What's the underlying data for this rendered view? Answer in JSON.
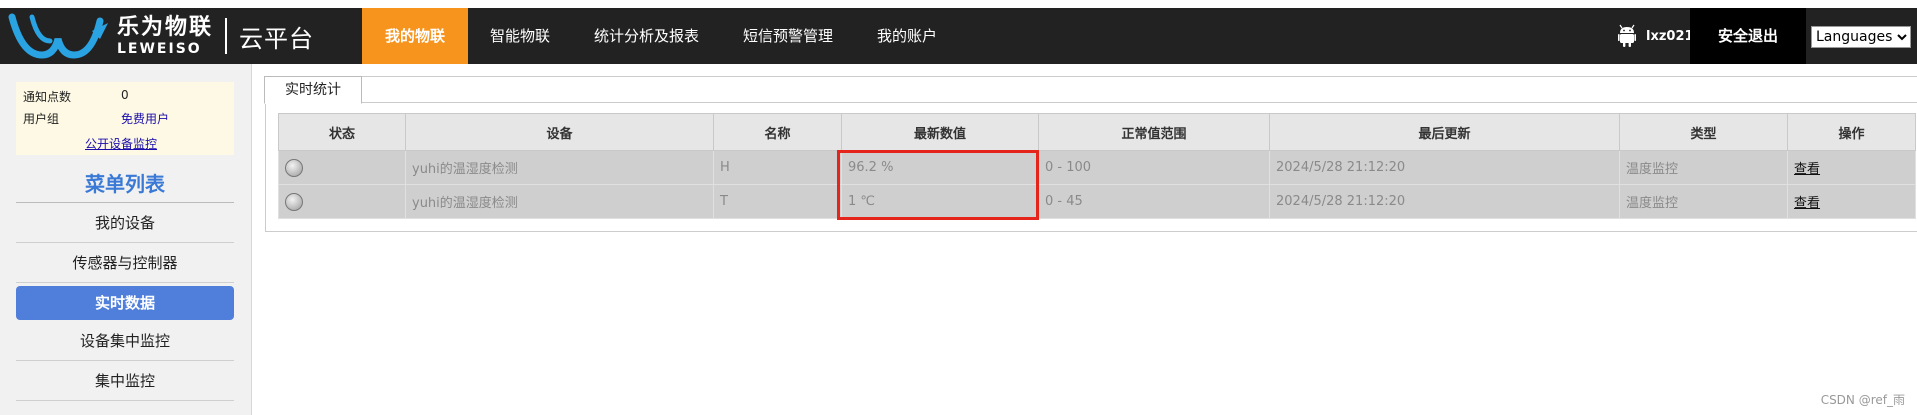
{
  "brand": {
    "name_cn": "乐为物联",
    "name_en": "LEWEISO",
    "product": "云平台",
    "colors": {
      "header_bg": "#222222",
      "active_nav": "#f7941d",
      "menu_active": "#4f7fdb",
      "highlight_box": "#e5241b"
    }
  },
  "nav": {
    "items": [
      {
        "label": "我的物联",
        "active": true
      },
      {
        "label": "智能物联"
      },
      {
        "label": "统计分析及报表"
      },
      {
        "label": "短信预警管理"
      },
      {
        "label": "我的账户"
      }
    ]
  },
  "user": {
    "icon": "android-icon",
    "name": "lxz021",
    "logout_label": "安全退出",
    "language_select": "Languages"
  },
  "sidebar": {
    "info": {
      "notify_key": "通知点数",
      "notify_val": "0",
      "group_key": "用户组",
      "group_val": "免费用户",
      "public_link": "公开设备监控"
    },
    "menu_title": "菜单列表",
    "items": [
      {
        "label": "我的设备"
      },
      {
        "label": "传感器与控制器"
      },
      {
        "label": "实时数据",
        "active": true
      },
      {
        "label": "设备集中监控"
      },
      {
        "label": "集中监控"
      }
    ]
  },
  "main": {
    "tab_label": "实时统计",
    "table": {
      "columns": [
        "状态",
        "设备",
        "名称",
        "最新数值",
        "正常值范围",
        "最后更新",
        "类型",
        "操作"
      ],
      "rows": [
        {
          "device": "yuhi的温湿度检测",
          "name": "H",
          "value": "96.2 %",
          "range": "0 - 100",
          "updated": "2024/5/28 21:12:20",
          "type": "温度监控",
          "action": "查看"
        },
        {
          "device": "yuhi的温湿度检测",
          "name": "T",
          "value": "1 ℃",
          "range": "0 - 45",
          "updated": "2024/5/28 21:12:20",
          "type": "温度监控",
          "action": "查看"
        }
      ]
    }
  },
  "watermark": "CSDN @ref_雨"
}
